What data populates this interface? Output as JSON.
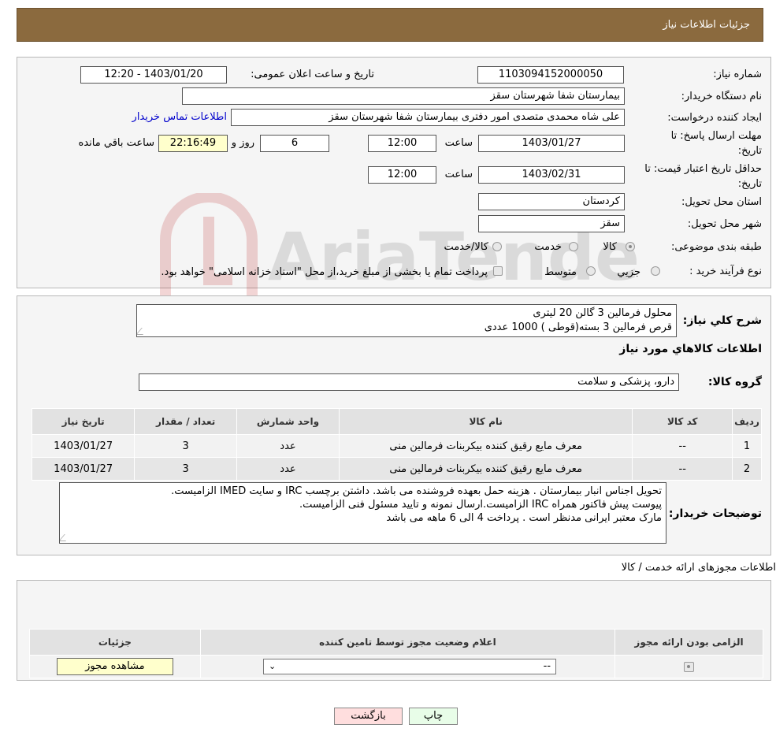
{
  "header": {
    "title": "جزئیات اطلاعات نیاز"
  },
  "form": {
    "need_number_label": "شماره نیاز:",
    "need_number": "1103094152000050",
    "announce_label": "تاریخ و ساعت اعلان عمومی:",
    "announce_value": "1403/01/20 - 12:20",
    "buyer_org_label": "نام دستگاه خریدار:",
    "buyer_org": "بیمارستان شفا شهرستان سقز",
    "requester_label": "ایجاد کننده درخواست:",
    "requester": "علی شاه محمدی متصدی امور دفتری بیمارستان شفا شهرستان سقز",
    "contact_link": "اطلاعات تماس خریدار",
    "deadline_label_1": "مهلت ارسال پاسخ: تا",
    "deadline_label_2": "تاریخ:",
    "deadline_date": "1403/01/27",
    "time_label": "ساعت",
    "deadline_time": "12:00",
    "days_value": "6",
    "days_label": "روز و",
    "remaining_time": "22:16:49",
    "remaining_label": "ساعت باقي مانده",
    "validity_label_1": "حداقل تاریخ اعتبار قیمت: تا",
    "validity_label_2": "تاریخ:",
    "validity_date": "1403/02/31",
    "validity_time": "12:00",
    "province_label": "استان محل تحویل:",
    "province": "کردستان",
    "city_label": "شهر محل تحویل:",
    "city": "سقز",
    "category_label": "طبقه بندی موضوعی:",
    "category_options": [
      "کالا",
      "خدمت",
      "کالا/خدمت"
    ],
    "purchase_type_label": "نوع فرآیند خرید :",
    "purchase_options": [
      "جزیي",
      "متوسط"
    ],
    "payment_note": "پرداخت تمام یا بخشی از مبلغ خرید،از محل \"اسناد خزانه اسلامی\" خواهد بود."
  },
  "summary": {
    "label": "شرح کلي نياز:",
    "lines": [
      "محلول فرمالین 3 گالن 20 لیتری",
      "قرص فرمالین 3 بسته(قوطی ) 1000 عددی"
    ],
    "goods_title": "اطلاعات کالاهاي مورد نياز",
    "group_label": "گروه کالا:",
    "group_value": "دارو، پزشکی و سلامت"
  },
  "items_table": {
    "headers": [
      "ردیف",
      "کد کالا",
      "نام کالا",
      "واحد شمارش",
      "تعداد / مقدار",
      "تاریخ نیاز"
    ],
    "rows": [
      [
        "1",
        "--",
        "معرف مایع رقیق کننده بیکربنات فرمالین منی",
        "عدد",
        "3",
        "1403/01/27"
      ],
      [
        "2",
        "--",
        "معرف مایع رقیق کننده بیکربنات فرمالین منی",
        "عدد",
        "3",
        "1403/01/27"
      ]
    ]
  },
  "buyer_notes": {
    "label": "توضیحات خریدار:",
    "lines": [
      "تحویل اجناس  انبار بیمارستان . هزینه حمل بعهده فروشنده می باشد.  داشتن برچسب IRC  و سایت  IMED  الزامیست.",
      "پیوست پیش فاکتور همراه IRC  الزامیست.ارسال نمونه و تایید مسئول فنی الزامیست.",
      "مارک معتبر ایرانی مدنظر است . پرداخت 4 الی 6 ماهه می باشد"
    ]
  },
  "permits": {
    "title": "اطلاعات مجوزهای ارائه خدمت / کالا",
    "headers": [
      "الزامی بودن ارائه مجوز",
      "اعلام وضعیت مجوز توسط تامین کننده",
      "جزئیات"
    ],
    "select_value": "--",
    "view_button": "مشاهده مجوز"
  },
  "buttons": {
    "print": "چاپ",
    "back": "بازگشت"
  },
  "watermark": "AriaTender.neT",
  "colors": {
    "header_bg": "#8b6a3e",
    "link": "#0000cc",
    "highlight": "#ffffcc",
    "back_btn": "#ffdede",
    "print_btn": "#e8fde8"
  }
}
